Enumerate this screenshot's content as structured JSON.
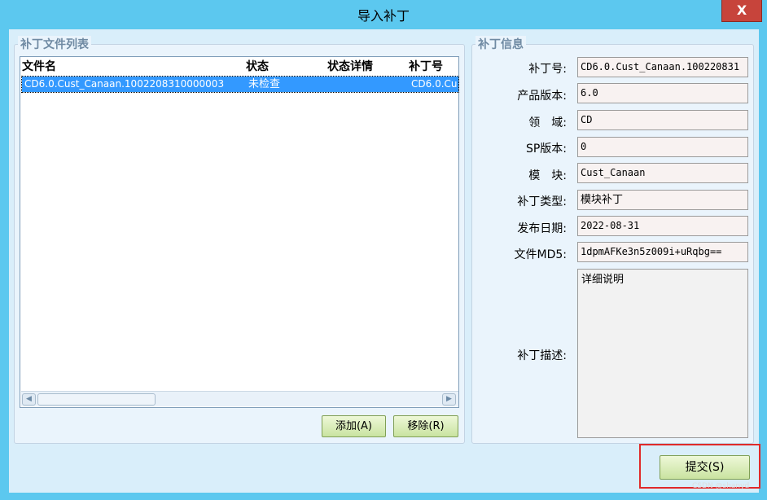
{
  "window": {
    "title": "导入补丁",
    "close_label": "X"
  },
  "patch_list": {
    "group_title": "补丁文件列表",
    "columns": [
      "文件名",
      "状态",
      "状态详情",
      "补丁号"
    ],
    "rows": [
      {
        "filename": "CD6.0.Cust_Canaan.1002208310000003",
        "status": "未检查",
        "status_detail": "",
        "patch_no": "CD6.0.Cu"
      }
    ],
    "add_button": "添加(A)",
    "remove_button": "移除(R)"
  },
  "patch_info": {
    "group_title": "补丁信息",
    "fields": [
      {
        "label": "补丁号:",
        "value": "CD6.0.Cust_Canaan.100220831"
      },
      {
        "label": "产品版本:",
        "value": "6.0"
      },
      {
        "label": "领　域:",
        "value": "CD"
      },
      {
        "label": "SP版本:",
        "value": "0"
      },
      {
        "label": "模　块:",
        "value": "Cust_Canaan"
      },
      {
        "label": "补丁类型:",
        "value": "模块补丁"
      },
      {
        "label": "发布日期:",
        "value": "2022-08-31"
      },
      {
        "label": "文件MD5:",
        "value": "1dpmAFKe3n5z009i+uRqbg=="
      }
    ],
    "description_label": "补丁描述:",
    "description_value": "详细说明"
  },
  "submit_button": "提交(S)",
  "watermark": "CSDN @shanyd"
}
